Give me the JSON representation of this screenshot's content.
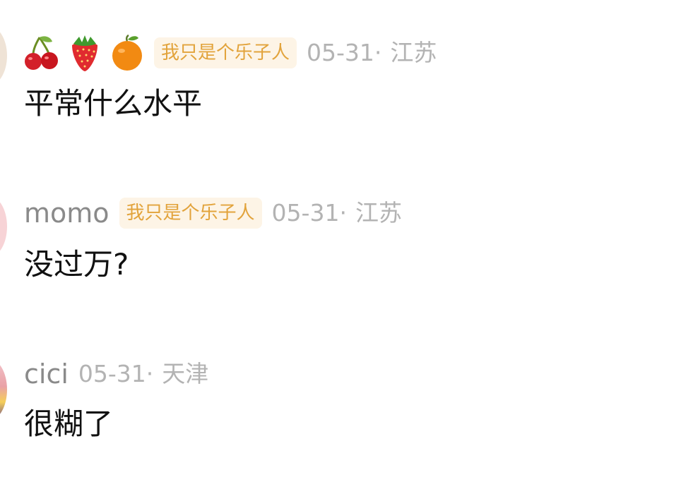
{
  "comments": [
    {
      "username_icons": [
        "cherry-icon",
        "strawberry-icon",
        "orange-icon"
      ],
      "badge": "我只是个乐子人",
      "date": "05-31",
      "separator": "·",
      "region": "江苏",
      "text": "平常什么水平"
    },
    {
      "username": "momo",
      "badge": "我只是个乐子人",
      "date": "05-31",
      "separator": "·",
      "region": "江苏",
      "text": "没过万?"
    },
    {
      "username": "cici",
      "date": "05-31",
      "separator": "·",
      "region": "天津",
      "text": "很糊了"
    }
  ],
  "colors": {
    "username": "#8a8a8a",
    "badge_text": "#e2a33b",
    "badge_bg": "#fdf4e6",
    "meta": "#b3b3b3",
    "body_text": "#111111"
  }
}
